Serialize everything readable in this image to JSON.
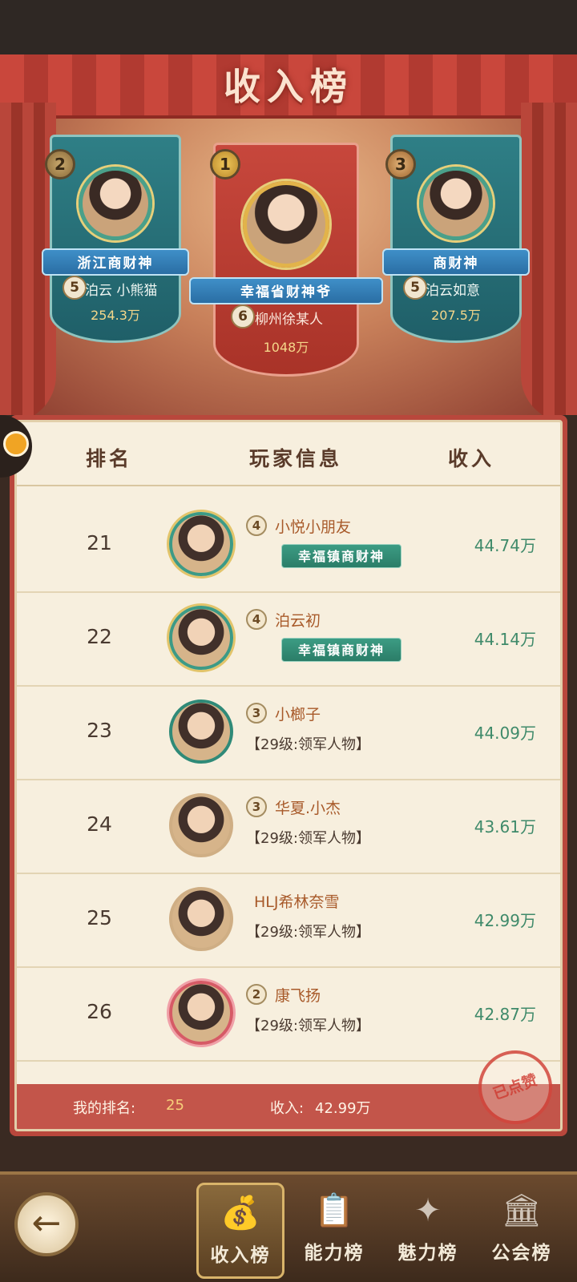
{
  "board_title": "收入榜",
  "podium": [
    {
      "rank": "2",
      "title": "浙江商财神",
      "level": "5",
      "name": "泊云  小熊猫",
      "income": "254.3万"
    },
    {
      "rank": "1",
      "title": "幸福省财神爷",
      "level": "6",
      "name": "柳州徐某人",
      "income": "1048万"
    },
    {
      "rank": "3",
      "title": "商财神",
      "level": "5",
      "name": "泊云如意",
      "income": "207.5万"
    }
  ],
  "table": {
    "headers": {
      "rank": "排名",
      "player": "玩家信息",
      "income": "收入"
    },
    "rows": [
      {
        "rank": "21",
        "level": "4",
        "name": "小悦小朋友",
        "title": "幸福镇商财神",
        "sub": "",
        "income": "44.74万"
      },
      {
        "rank": "22",
        "level": "4",
        "name": "泊云初",
        "title": "幸福镇商财神",
        "sub": "",
        "income": "44.14万"
      },
      {
        "rank": "23",
        "level": "3",
        "name": "小榔子",
        "title": "",
        "sub": "【29级:领军人物】",
        "income": "44.09万"
      },
      {
        "rank": "24",
        "level": "3",
        "name": "华夏.小杰",
        "title": "",
        "sub": "【29级:领军人物】",
        "income": "43.61万"
      },
      {
        "rank": "25",
        "level": "",
        "name": "HLJ希林奈雪",
        "title": "",
        "sub": "【29级:领军人物】",
        "income": "42.99万"
      },
      {
        "rank": "26",
        "level": "2",
        "name": "康飞扬",
        "title": "",
        "sub": "【29级:领军人物】",
        "income": "42.87万"
      }
    ]
  },
  "my_rank": {
    "label": "我的排名:",
    "value": "25",
    "income_label": "收入:",
    "income_value": "42.99万",
    "stamp": "已点赞"
  },
  "tabs": [
    {
      "label": "收入榜",
      "icon": "money-icon",
      "active": true
    },
    {
      "label": "能力榜",
      "icon": "clipboard-icon",
      "active": false
    },
    {
      "label": "魅力榜",
      "icon": "sparkle-icon",
      "active": false
    },
    {
      "label": "公会榜",
      "icon": "guild-hall-icon",
      "active": false
    }
  ],
  "colors": {
    "accent_red": "#c3554a",
    "income_green": "#3f8a6a",
    "gold": "#f5d78a"
  }
}
